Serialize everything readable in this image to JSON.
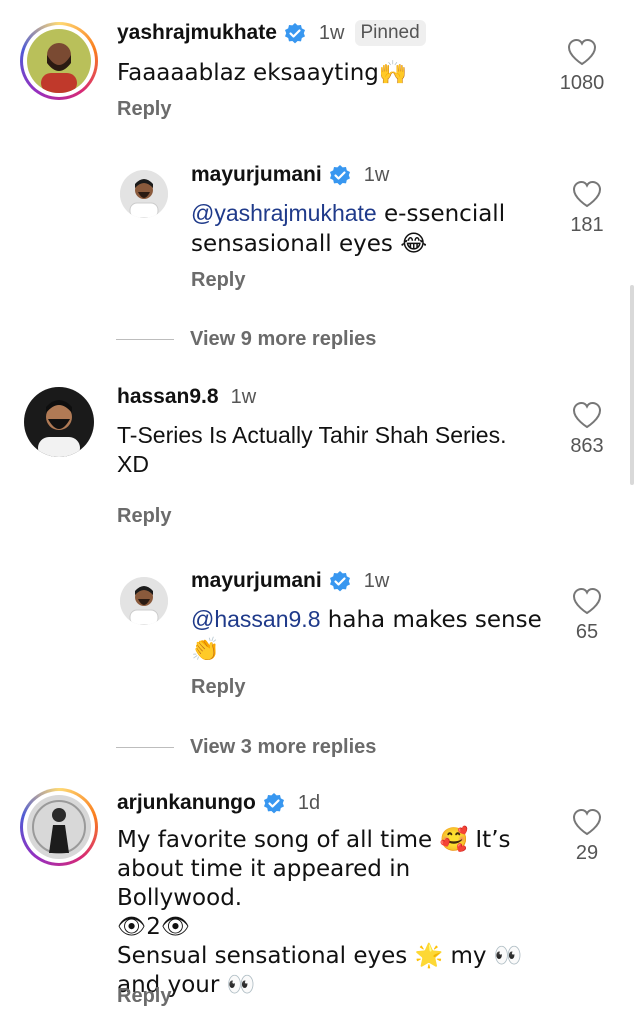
{
  "comments": [
    {
      "username": "yashrajmukhate",
      "verified": true,
      "time": "1w",
      "badge": "Pinned",
      "text": "Faaaaablaz eksaayting🙌",
      "likes": "1080",
      "reply_label": "Reply"
    },
    {
      "username": "mayurjumani",
      "verified": true,
      "time": "1w",
      "mention": "@yashrajmukhate",
      "text": " e-ssenciall sensasionall eyes 😂",
      "likes": "181",
      "reply_label": "Reply"
    },
    {
      "username": "hassan9.8",
      "verified": false,
      "time": "1w",
      "text": "T-Series Is Actually Tahir Shah Series. XD",
      "likes": "863",
      "reply_label": "Reply"
    },
    {
      "username": "mayurjumani",
      "verified": true,
      "time": "1w",
      "mention": "@hassan9.8",
      "text": " haha makes sense 👏",
      "likes": "65",
      "reply_label": "Reply"
    },
    {
      "username": "arjunkanungo",
      "verified": true,
      "time": "1d",
      "text_lines": [
        "My favorite song of all time 🥰 It’s",
        "about time it appeared in Bollywood.",
        "👁2👁",
        "Sensual sensational eyes 🌟 my 👀",
        "and your 👀"
      ],
      "likes": "29",
      "reply_label": "Reply"
    }
  ],
  "view_more": [
    {
      "label": "View 9 more replies"
    },
    {
      "label": "View 3 more replies"
    }
  ],
  "icons": {
    "heart": "heart-outline-icon",
    "verified": "verified-badge-icon"
  },
  "colors": {
    "verified_blue": "#3897f0",
    "mention": "#1f3a8a",
    "muted": "#6b6b6b"
  }
}
